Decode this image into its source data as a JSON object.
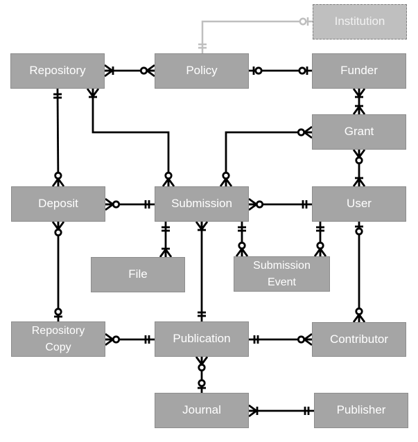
{
  "diagram": {
    "type": "entity-relationship",
    "notation": "crow's foot",
    "colors": {
      "entity_fill": "#a5a5a5",
      "entity_text": "#ffffff",
      "line": "#000000",
      "optional_entity_fill": "#bfbfbf",
      "optional_line": "#bfbfbf"
    },
    "entities": [
      {
        "id": "institution",
        "label": "Institution",
        "style": "dashed"
      },
      {
        "id": "repository",
        "label": "Repository"
      },
      {
        "id": "policy",
        "label": "Policy"
      },
      {
        "id": "funder",
        "label": "Funder"
      },
      {
        "id": "grant",
        "label": "Grant"
      },
      {
        "id": "deposit",
        "label": "Deposit"
      },
      {
        "id": "submission",
        "label": "Submission"
      },
      {
        "id": "user",
        "label": "User"
      },
      {
        "id": "file",
        "label": "File"
      },
      {
        "id": "submission_event",
        "label": "Submission\nEvent"
      },
      {
        "id": "repository_copy",
        "label": "Repository\nCopy"
      },
      {
        "id": "publication",
        "label": "Publication"
      },
      {
        "id": "contributor",
        "label": "Contributor"
      },
      {
        "id": "journal",
        "label": "Journal"
      },
      {
        "id": "publisher",
        "label": "Publisher"
      }
    ],
    "relationships": [
      {
        "from": "policy",
        "to": "institution",
        "from_card": "one-and-only-one",
        "to_card": "zero-or-one",
        "style": "faded"
      },
      {
        "from": "repository",
        "to": "policy",
        "from_card": "one-or-many",
        "to_card": "zero-or-many"
      },
      {
        "from": "policy",
        "to": "funder",
        "from_card": "zero-or-one",
        "to_card": "zero-or-one"
      },
      {
        "from": "funder",
        "to": "grant",
        "from_card": "one-or-many",
        "to_card": "one-or-many"
      },
      {
        "from": "repository",
        "to": "deposit",
        "from_card": "one-and-only-one",
        "to_card": "zero-or-many"
      },
      {
        "from": "repository",
        "to": "submission",
        "from_card": "one-or-many",
        "to_card": "zero-or-many"
      },
      {
        "from": "grant",
        "to": "submission",
        "from_card": "zero-or-many",
        "to_card": "zero-or-many"
      },
      {
        "from": "grant",
        "to": "user",
        "from_card": "zero-or-many",
        "to_card": "one-or-many"
      },
      {
        "from": "deposit",
        "to": "submission",
        "from_card": "zero-or-many",
        "to_card": "one-and-only-one"
      },
      {
        "from": "submission",
        "to": "user",
        "from_card": "zero-or-many",
        "to_card": "one-and-only-one"
      },
      {
        "from": "submission",
        "to": "file",
        "from_card": "one-and-only-one",
        "to_card": "one-or-many"
      },
      {
        "from": "submission",
        "to": "submission_event",
        "from_card": "one-and-only-one",
        "to_card": "zero-or-many"
      },
      {
        "from": "user",
        "to": "submission_event",
        "from_card": "one-and-only-one",
        "to_card": "zero-or-many"
      },
      {
        "from": "deposit",
        "to": "repository_copy",
        "from_card": "zero-or-many",
        "to_card": "zero-or-one"
      },
      {
        "from": "submission",
        "to": "publication",
        "from_card": "one-or-many",
        "to_card": "one-and-only-one"
      },
      {
        "from": "user",
        "to": "contributor",
        "from_card": "zero-or-one",
        "to_card": "zero-or-many"
      },
      {
        "from": "repository_copy",
        "to": "publication",
        "from_card": "zero-or-many",
        "to_card": "one-and-only-one"
      },
      {
        "from": "publication",
        "to": "contributor",
        "from_card": "one-and-only-one",
        "to_card": "zero-or-many"
      },
      {
        "from": "publication",
        "to": "journal",
        "from_card": "zero-or-many",
        "to_card": "zero-or-one"
      },
      {
        "from": "journal",
        "to": "publisher",
        "from_card": "one-or-many",
        "to_card": "one-and-only-one"
      }
    ]
  }
}
